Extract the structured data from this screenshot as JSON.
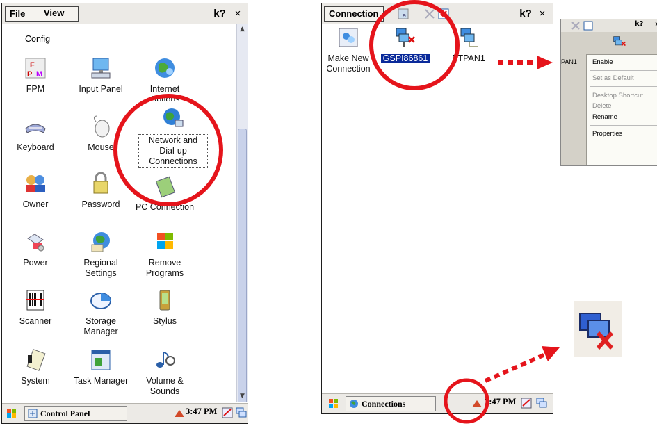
{
  "left_screen": {
    "menu": {
      "file": "File",
      "view": "View"
    },
    "help_label": "k?",
    "close_label": "×",
    "partial_label": "Config",
    "items": [
      {
        "label": "FPM",
        "icon": "fpm-icon"
      },
      {
        "label": "Input Panel",
        "icon": "input-panel-icon"
      },
      {
        "label": "Internet Options",
        "icon": "internet-options-icon"
      },
      {
        "label": "Keyboard",
        "icon": "keyboard-icon"
      },
      {
        "label": "Mouse",
        "icon": "mouse-icon"
      },
      {
        "label": "Network and Dial-up Connections",
        "icon": "network-icon"
      },
      {
        "label": "Owner",
        "icon": "owner-icon"
      },
      {
        "label": "Password",
        "icon": "password-icon"
      },
      {
        "label": "PC Connection",
        "icon": "pc-connection-icon"
      },
      {
        "label": "Power",
        "icon": "power-icon"
      },
      {
        "label": "Regional Settings",
        "icon": "regional-settings-icon"
      },
      {
        "label": "Remove Programs",
        "icon": "remove-programs-icon"
      },
      {
        "label": "Scanner",
        "icon": "scanner-icon"
      },
      {
        "label": "Storage Manager",
        "icon": "storage-manager-icon"
      },
      {
        "label": "Stylus",
        "icon": "stylus-icon"
      },
      {
        "label": "System",
        "icon": "system-icon"
      },
      {
        "label": "Task Manager",
        "icon": "task-manager-icon"
      },
      {
        "label": "Volume & Sounds",
        "icon": "volume-icon"
      }
    ],
    "taskbar": {
      "task_label": "Control Panel",
      "clock": "3:47 PM"
    }
  },
  "right_screen": {
    "menu": {
      "connection": "Connection"
    },
    "help_label": "k?",
    "close_label": "×",
    "items": [
      {
        "label": "Make New Connection",
        "icon": "make-new-connection-icon"
      },
      {
        "label": "GSPI86861",
        "icon": "gspi-connection-icon"
      },
      {
        "label": "BTPAN1",
        "icon": "btpan-connection-icon"
      }
    ],
    "taskbar": {
      "task_label": "Connections",
      "clock": "3:47 PM"
    }
  },
  "context_menu": {
    "partial_label": "PAN1",
    "items": [
      "Enable",
      "Set as Default",
      "Desktop Shortcut",
      "Delete",
      "Rename",
      "Properties"
    ]
  },
  "colors": {
    "highlight_red": "#e5141b",
    "selection_blue": "#0a2a9a",
    "taskbar": "#eceae6"
  }
}
